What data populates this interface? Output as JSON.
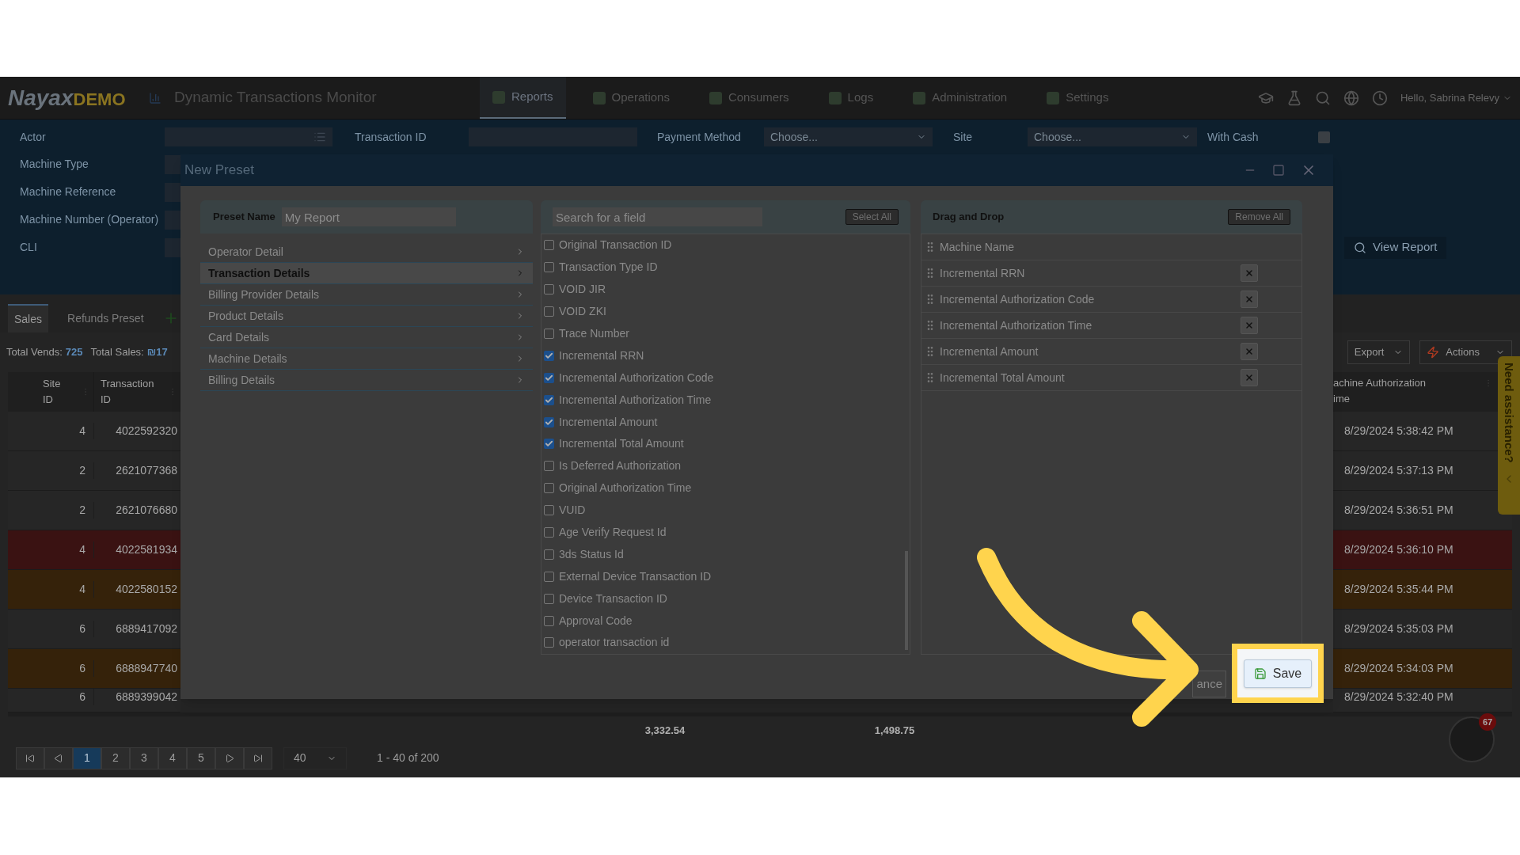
{
  "header": {
    "logo": "Nayax",
    "logo_suffix": "DEMO",
    "page_title": "Dynamic Transactions Monitor",
    "nav": [
      {
        "label": "Reports",
        "selected": true
      },
      {
        "label": "Operations",
        "selected": false
      },
      {
        "label": "Consumers",
        "selected": false
      },
      {
        "label": "Logs",
        "selected": false
      },
      {
        "label": "Administration",
        "selected": false
      },
      {
        "label": "Settings",
        "selected": false
      }
    ],
    "greeting": "Hello, Sabrina Relevy"
  },
  "filters": {
    "actor": "Actor",
    "transaction_id": "Transaction ID",
    "payment_method": {
      "label": "Payment Method",
      "placeholder": "Choose..."
    },
    "site": {
      "label": "Site",
      "placeholder": "Choose..."
    },
    "with_cash": {
      "label": "With Cash",
      "checked": false
    },
    "left_labels": [
      "Machine Type",
      "Machine Reference",
      "Machine Number (Operator)",
      "CLI"
    ],
    "view_report": "View Report"
  },
  "report_tabs": [
    {
      "label": "Sales",
      "selected": true
    },
    {
      "label": "Refunds Preset",
      "selected": false
    }
  ],
  "totals": {
    "vends_label": "Total Vends:",
    "vends": "725",
    "sales_label": "Total Sales:",
    "sales": "₪17"
  },
  "export": "Export",
  "actions": "Actions",
  "table": {
    "columns": [
      "Site ID",
      "Transaction ID"
    ],
    "right_column": [
      "achine Authorization",
      "ime"
    ],
    "rows": [
      {
        "site_id": "4",
        "transaction_id": "4022592320",
        "time": "8/29/2024 5:38:42 PM",
        "color": "#262626"
      },
      {
        "site_id": "2",
        "transaction_id": "2621077368",
        "time": "8/29/2024 5:37:13 PM",
        "color": "#262626"
      },
      {
        "site_id": "2",
        "transaction_id": "2621076680",
        "time": "8/29/2024 5:36:51 PM",
        "color": "#262626"
      },
      {
        "site_id": "4",
        "transaction_id": "4022581934",
        "time": "8/29/2024 5:36:10 PM",
        "color": "#3a1212"
      },
      {
        "site_id": "4",
        "transaction_id": "4022580152",
        "time": "8/29/2024 5:35:44 PM",
        "color": "#35220a"
      },
      {
        "site_id": "6",
        "transaction_id": "6889417092",
        "time": "8/29/2024 5:35:03 PM",
        "color": "#262626"
      },
      {
        "site_id": "6",
        "transaction_id": "6888947740",
        "time": "8/29/2024 5:34:03 PM",
        "color": "#35220a"
      },
      {
        "site_id": "6",
        "transaction_id": "6889399042",
        "time": "8/29/2024 5:32:40 PM",
        "color": "#262626"
      }
    ],
    "footer_totals": [
      "3,332.54",
      "1,498.75"
    ]
  },
  "pager": {
    "pages": [
      {
        "label": "1",
        "selected": true
      },
      {
        "label": "2",
        "selected": false
      },
      {
        "label": "3",
        "selected": false
      },
      {
        "label": "4",
        "selected": false
      },
      {
        "label": "5",
        "selected": false
      }
    ],
    "page_size": "40",
    "range": "1 - 40 of 200"
  },
  "modal": {
    "title": "New Preset",
    "preset_name_label": "Preset Name",
    "preset_name": "My Report",
    "categories": [
      {
        "label": "Operator Detail",
        "selected": false
      },
      {
        "label": "Transaction Details",
        "selected": true
      },
      {
        "label": "Billing Provider Details",
        "selected": false
      },
      {
        "label": "Product Details",
        "selected": false
      },
      {
        "label": "Card Details",
        "selected": false
      },
      {
        "label": "Machine Details",
        "selected": false
      },
      {
        "label": "Billing Details",
        "selected": false
      }
    ],
    "search_placeholder": "Search for a field",
    "select_all": "Select All",
    "fields": [
      {
        "label": "Original Transaction ID",
        "checked": false
      },
      {
        "label": "Transaction Type ID",
        "checked": false
      },
      {
        "label": "VOID JIR",
        "checked": false
      },
      {
        "label": "VOID ZKI",
        "checked": false
      },
      {
        "label": "Trace Number",
        "checked": false
      },
      {
        "label": "Incremental RRN",
        "checked": true
      },
      {
        "label": "Incremental Authorization Code",
        "checked": true
      },
      {
        "label": "Incremental Authorization Time",
        "checked": true
      },
      {
        "label": "Incremental Amount",
        "checked": true
      },
      {
        "label": "Incremental Total Amount",
        "checked": true
      },
      {
        "label": "Is Deferred Authorization",
        "checked": false
      },
      {
        "label": "Original Authorization Time",
        "checked": false
      },
      {
        "label": "VUID",
        "checked": false
      },
      {
        "label": "Age Verify Request Id",
        "checked": false
      },
      {
        "label": "3ds Status Id",
        "checked": false
      },
      {
        "label": "External Device Transaction ID",
        "checked": false
      },
      {
        "label": "Device Transaction ID",
        "checked": false
      },
      {
        "label": "Approval Code",
        "checked": false
      },
      {
        "label": "operator transaction id",
        "checked": false
      }
    ],
    "drop_title": "Drag and Drop",
    "remove_all": "Remove All",
    "selected_fields": [
      {
        "label": "Machine Name",
        "removable": false
      },
      {
        "label": "Incremental RRN",
        "removable": true
      },
      {
        "label": "Incremental Authorization Code",
        "removable": true
      },
      {
        "label": "Incremental Authorization Time",
        "removable": true
      },
      {
        "label": "Incremental Amount",
        "removable": true
      },
      {
        "label": "Incremental Total Amount",
        "removable": true
      }
    ],
    "cancel": "ance",
    "save": "Save"
  },
  "assistance": "Need assistance?",
  "notification_count": "67"
}
